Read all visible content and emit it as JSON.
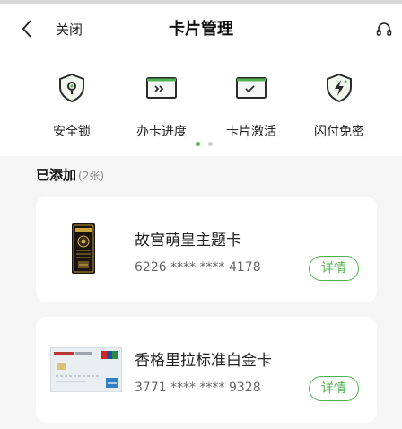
{
  "header": {
    "close_label": "关闭",
    "title": "卡片管理"
  },
  "actions": [
    {
      "label": "安全锁",
      "icon": "shield-lock-icon"
    },
    {
      "label": "办卡进度",
      "icon": "progress-card-icon"
    },
    {
      "label": "卡片激活",
      "icon": "card-activate-icon"
    },
    {
      "label": "闪付免密",
      "icon": "flash-pay-icon"
    }
  ],
  "carousel": {
    "pages": 2,
    "active_page": 1
  },
  "added": {
    "title": "已添加",
    "count": "(2张)"
  },
  "cards": [
    {
      "name": "故宫萌皇主题卡",
      "number": "6226 **** **** 4178",
      "detail_label": "详情"
    },
    {
      "name": "香格里拉标准白金卡",
      "number": "3771 **** **** 9328",
      "detail_label": "详情"
    }
  ],
  "colors": {
    "accent": "#4fb34f",
    "icon_dark": "#2b2b2b",
    "panel_bg": "#f5f5f5"
  }
}
